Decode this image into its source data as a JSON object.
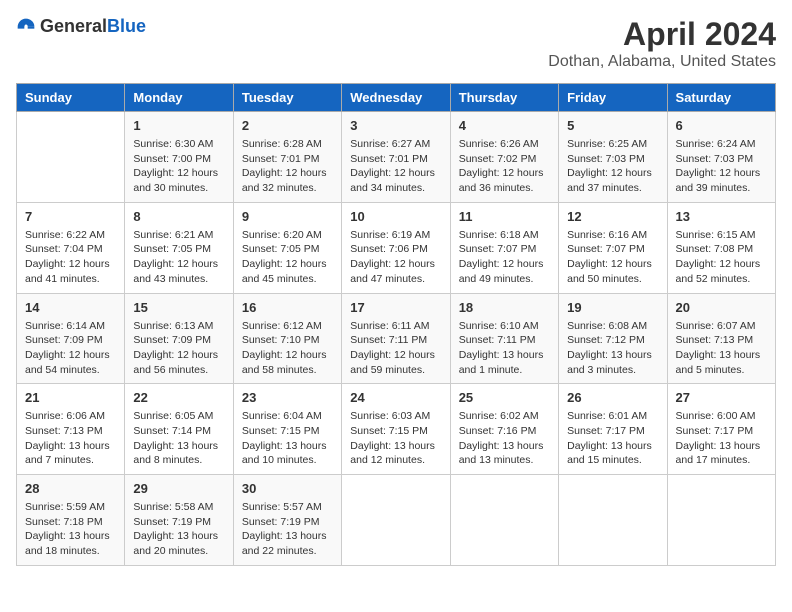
{
  "header": {
    "logo_general": "General",
    "logo_blue": "Blue",
    "title": "April 2024",
    "subtitle": "Dothan, Alabama, United States"
  },
  "calendar": {
    "days_of_week": [
      "Sunday",
      "Monday",
      "Tuesday",
      "Wednesday",
      "Thursday",
      "Friday",
      "Saturday"
    ],
    "weeks": [
      [
        {
          "day": "",
          "sunrise": "",
          "sunset": "",
          "daylight": ""
        },
        {
          "day": "1",
          "sunrise": "6:30 AM",
          "sunset": "7:00 PM",
          "daylight": "12 hours and 30 minutes."
        },
        {
          "day": "2",
          "sunrise": "6:28 AM",
          "sunset": "7:01 PM",
          "daylight": "12 hours and 32 minutes."
        },
        {
          "day": "3",
          "sunrise": "6:27 AM",
          "sunset": "7:01 PM",
          "daylight": "12 hours and 34 minutes."
        },
        {
          "day": "4",
          "sunrise": "6:26 AM",
          "sunset": "7:02 PM",
          "daylight": "12 hours and 36 minutes."
        },
        {
          "day": "5",
          "sunrise": "6:25 AM",
          "sunset": "7:03 PM",
          "daylight": "12 hours and 37 minutes."
        },
        {
          "day": "6",
          "sunrise": "6:24 AM",
          "sunset": "7:03 PM",
          "daylight": "12 hours and 39 minutes."
        }
      ],
      [
        {
          "day": "7",
          "sunrise": "6:22 AM",
          "sunset": "7:04 PM",
          "daylight": "12 hours and 41 minutes."
        },
        {
          "day": "8",
          "sunrise": "6:21 AM",
          "sunset": "7:05 PM",
          "daylight": "12 hours and 43 minutes."
        },
        {
          "day": "9",
          "sunrise": "6:20 AM",
          "sunset": "7:05 PM",
          "daylight": "12 hours and 45 minutes."
        },
        {
          "day": "10",
          "sunrise": "6:19 AM",
          "sunset": "7:06 PM",
          "daylight": "12 hours and 47 minutes."
        },
        {
          "day": "11",
          "sunrise": "6:18 AM",
          "sunset": "7:07 PM",
          "daylight": "12 hours and 49 minutes."
        },
        {
          "day": "12",
          "sunrise": "6:16 AM",
          "sunset": "7:07 PM",
          "daylight": "12 hours and 50 minutes."
        },
        {
          "day": "13",
          "sunrise": "6:15 AM",
          "sunset": "7:08 PM",
          "daylight": "12 hours and 52 minutes."
        }
      ],
      [
        {
          "day": "14",
          "sunrise": "6:14 AM",
          "sunset": "7:09 PM",
          "daylight": "12 hours and 54 minutes."
        },
        {
          "day": "15",
          "sunrise": "6:13 AM",
          "sunset": "7:09 PM",
          "daylight": "12 hours and 56 minutes."
        },
        {
          "day": "16",
          "sunrise": "6:12 AM",
          "sunset": "7:10 PM",
          "daylight": "12 hours and 58 minutes."
        },
        {
          "day": "17",
          "sunrise": "6:11 AM",
          "sunset": "7:11 PM",
          "daylight": "12 hours and 59 minutes."
        },
        {
          "day": "18",
          "sunrise": "6:10 AM",
          "sunset": "7:11 PM",
          "daylight": "13 hours and 1 minute."
        },
        {
          "day": "19",
          "sunrise": "6:08 AM",
          "sunset": "7:12 PM",
          "daylight": "13 hours and 3 minutes."
        },
        {
          "day": "20",
          "sunrise": "6:07 AM",
          "sunset": "7:13 PM",
          "daylight": "13 hours and 5 minutes."
        }
      ],
      [
        {
          "day": "21",
          "sunrise": "6:06 AM",
          "sunset": "7:13 PM",
          "daylight": "13 hours and 7 minutes."
        },
        {
          "day": "22",
          "sunrise": "6:05 AM",
          "sunset": "7:14 PM",
          "daylight": "13 hours and 8 minutes."
        },
        {
          "day": "23",
          "sunrise": "6:04 AM",
          "sunset": "7:15 PM",
          "daylight": "13 hours and 10 minutes."
        },
        {
          "day": "24",
          "sunrise": "6:03 AM",
          "sunset": "7:15 PM",
          "daylight": "13 hours and 12 minutes."
        },
        {
          "day": "25",
          "sunrise": "6:02 AM",
          "sunset": "7:16 PM",
          "daylight": "13 hours and 13 minutes."
        },
        {
          "day": "26",
          "sunrise": "6:01 AM",
          "sunset": "7:17 PM",
          "daylight": "13 hours and 15 minutes."
        },
        {
          "day": "27",
          "sunrise": "6:00 AM",
          "sunset": "7:17 PM",
          "daylight": "13 hours and 17 minutes."
        }
      ],
      [
        {
          "day": "28",
          "sunrise": "5:59 AM",
          "sunset": "7:18 PM",
          "daylight": "13 hours and 18 minutes."
        },
        {
          "day": "29",
          "sunrise": "5:58 AM",
          "sunset": "7:19 PM",
          "daylight": "13 hours and 20 minutes."
        },
        {
          "day": "30",
          "sunrise": "5:57 AM",
          "sunset": "7:19 PM",
          "daylight": "13 hours and 22 minutes."
        },
        {
          "day": "",
          "sunrise": "",
          "sunset": "",
          "daylight": ""
        },
        {
          "day": "",
          "sunrise": "",
          "sunset": "",
          "daylight": ""
        },
        {
          "day": "",
          "sunrise": "",
          "sunset": "",
          "daylight": ""
        },
        {
          "day": "",
          "sunrise": "",
          "sunset": "",
          "daylight": ""
        }
      ]
    ]
  }
}
